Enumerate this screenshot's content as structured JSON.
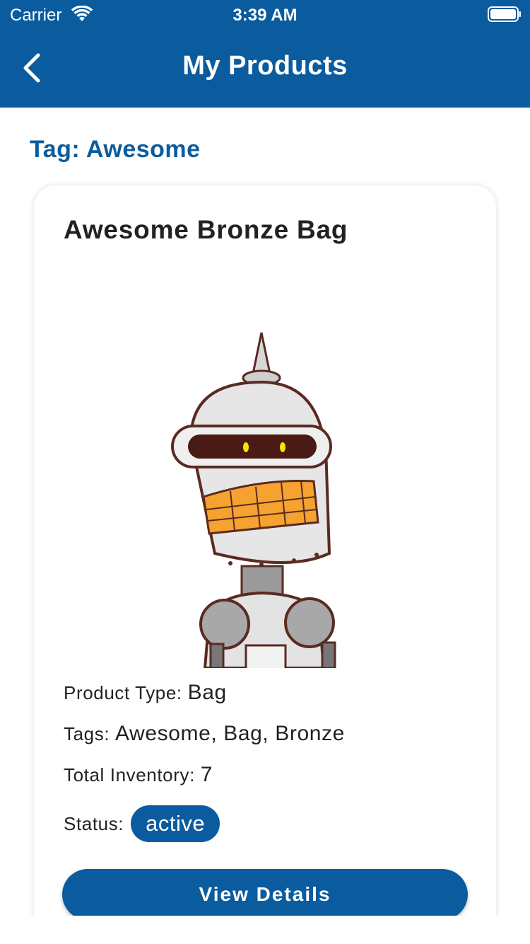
{
  "status_bar": {
    "carrier": "Carrier",
    "time": "3:39 AM",
    "icons": [
      "wifi-icon",
      "battery-icon"
    ]
  },
  "nav": {
    "title": "My Products",
    "back_icon": "chevron-left-icon"
  },
  "tag_heading": "Tag: Awesome",
  "product": {
    "title": "Awesome Bronze Bag",
    "image": "robot-product-image",
    "type_label": "Product Type:",
    "type_value": "Bag",
    "tags_label": "Tags:",
    "tags_value": "Awesome, Bag, Bronze",
    "inventory_label": "Total Inventory:",
    "inventory_value": "7",
    "status_label": "Status:",
    "status_value": "active",
    "button_label": "View Details"
  },
  "colors": {
    "primary": "#0a5c9e",
    "background": "#ffffff",
    "text": "#222222"
  }
}
